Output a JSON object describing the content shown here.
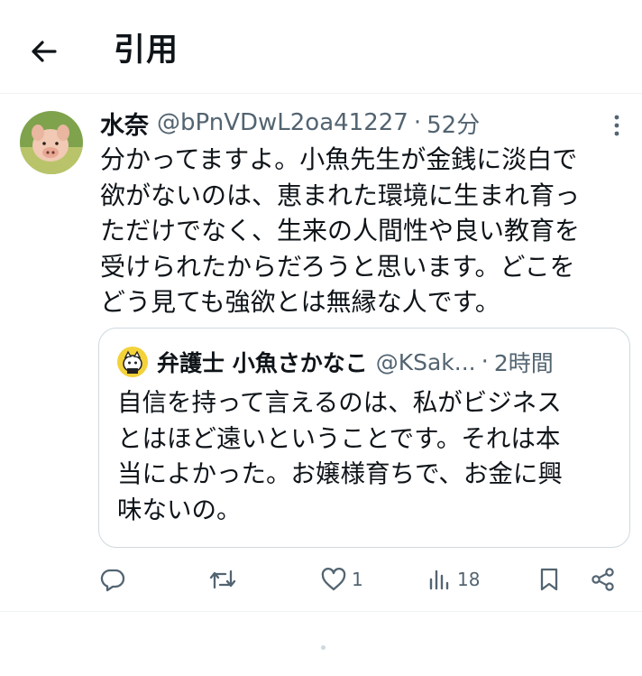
{
  "header": {
    "title": "引用"
  },
  "tweet": {
    "author_name": "水奈",
    "author_handle": "@bPnVDwL2oa41227",
    "separator": "·",
    "time": "52分",
    "text_lines": [
      "分かってますよ。小魚先生が金銭に淡白で",
      "欲がないのは、恵まれた環境に生まれ育っ",
      "ただけでなく、生来の人間性や良い教育を",
      "受けられたからだろうと思います。どこを",
      "どう見ても強欲とは無縁な人です。"
    ]
  },
  "quoted_tweet": {
    "author_name": "弁護士 小魚さかなこ",
    "author_handle": "@KSak...",
    "separator": "·",
    "time": "2時間",
    "text_lines": [
      "自信を持って言えるのは、私がビジネス",
      "とはほど遠いということです。それは本",
      "当によかった。お嬢様育ちで、お金に興",
      "味ないの。"
    ]
  },
  "actions": {
    "likes": "1",
    "views": "18"
  },
  "icons": {
    "back": "arrow-left-icon",
    "more": "more-vertical-icon",
    "reply": "reply-icon",
    "retweet": "retweet-icon",
    "like": "heart-icon",
    "views": "views-icon",
    "bookmark": "bookmark-icon",
    "share": "share-icon"
  },
  "colors": {
    "text": "#0f1419",
    "secondary": "#536471",
    "border": "#cfd9de"
  }
}
